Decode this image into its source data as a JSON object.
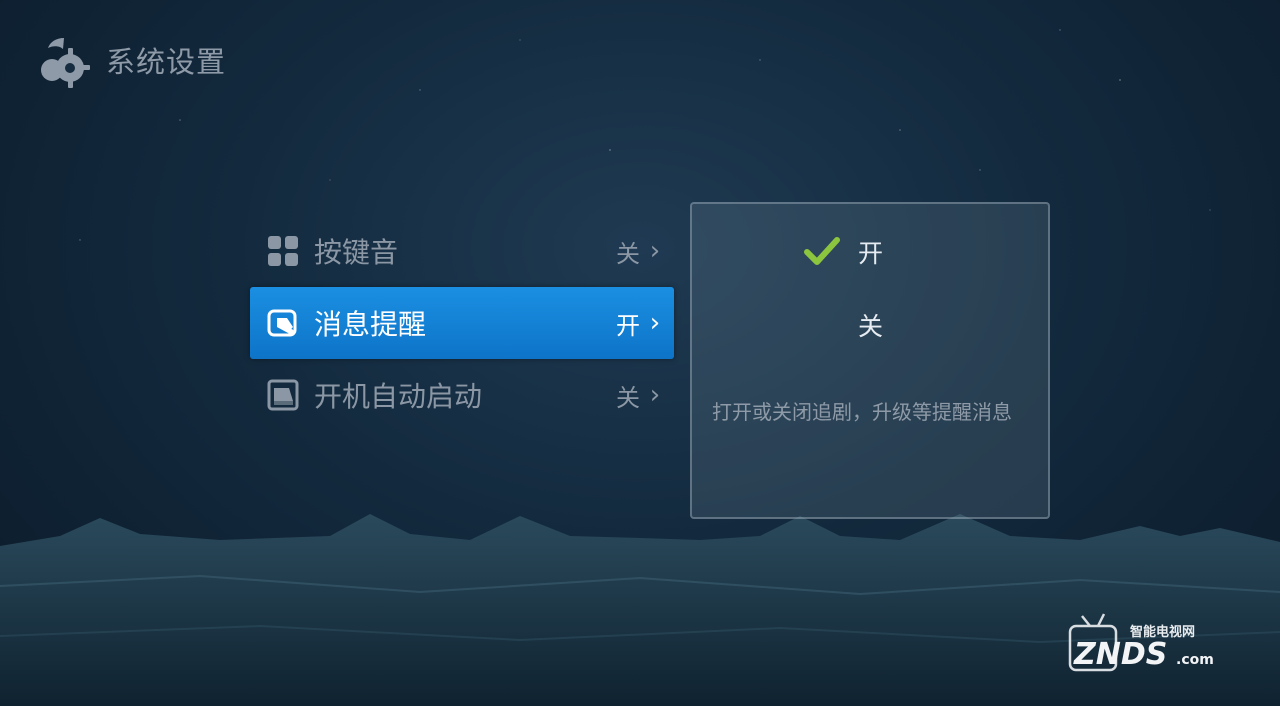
{
  "header": {
    "title": "系统设置",
    "icon": "settings-gear-logo-icon"
  },
  "menu": {
    "items": [
      {
        "label": "按键音",
        "value": "关",
        "icon": "grid-icon",
        "active": false
      },
      {
        "label": "消息提醒",
        "value": "开",
        "icon": "message-tag-icon",
        "active": true
      },
      {
        "label": "开机自动启动",
        "value": "关",
        "icon": "picture-frame-icon",
        "active": false
      }
    ],
    "chevron": "›"
  },
  "panel": {
    "options": [
      {
        "label": "开",
        "checked": true
      },
      {
        "label": "关",
        "checked": false
      }
    ],
    "description": "打开或关闭追剧，升级等提醒消息"
  },
  "watermark": {
    "brand": "ZNDS",
    "domain": ".com",
    "tagline": "智能电视网"
  },
  "colors": {
    "accent": "#1b8fe2",
    "check": "#8cc63f"
  }
}
